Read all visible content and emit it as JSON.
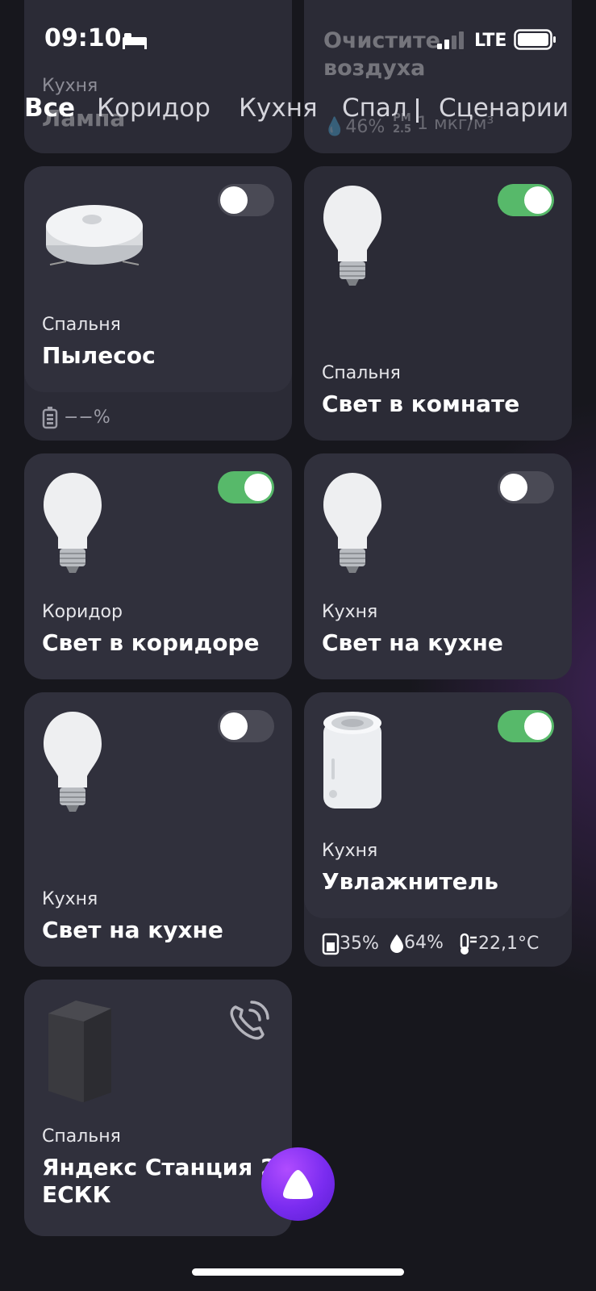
{
  "status_bar": {
    "time": "09:10",
    "network": "LTE"
  },
  "tabs": [
    {
      "label": "Все",
      "active": true
    },
    {
      "label": "Коридор",
      "active": false
    },
    {
      "label": "Кухня",
      "active": false
    },
    {
      "label": "Спал",
      "active": false
    },
    {
      "label": "Сценарии",
      "active": false
    }
  ],
  "top_cards": {
    "left": {
      "room": "Кухня",
      "name": "Лампа"
    },
    "right": {
      "name_line1": "Очистите",
      "name_line2": "воздуха",
      "humidity": "46%",
      "pm_label": "PM",
      "pm_sub": "2.5",
      "pm_value": "1 мкг/м³"
    }
  },
  "devices": [
    {
      "room": "Спальня",
      "name": "Пылесос",
      "state": "off",
      "battery": "−−%",
      "icon": "robot-vacuum-icon"
    },
    {
      "room": "Спальня",
      "name": "Свет в комнате",
      "state": "on",
      "icon": "lightbulb-icon"
    },
    {
      "room": "Коридор",
      "name": "Свет в коридоре",
      "state": "on",
      "icon": "lightbulb-icon"
    },
    {
      "room": "Кухня",
      "name": "Свет на кухне",
      "state": "off",
      "icon": "lightbulb-icon"
    },
    {
      "room": "Кухня",
      "name": "Свет на кухне",
      "state": "off",
      "icon": "lightbulb-icon"
    },
    {
      "room": "Кухня",
      "name": "Увлажнитель",
      "state": "on",
      "icon": "humidifier-icon",
      "water_level": "35%",
      "humidity": "64%",
      "temperature": "22,1°C"
    },
    {
      "room": "Спальня",
      "name_line1": "Яндекс Станция 2",
      "name_line2": "ЕСКК",
      "icon": "smart-speaker-icon"
    }
  ],
  "colors": {
    "toggle_on": "#57b96a",
    "toggle_off": "#4a4a55",
    "card": "#2b2b36",
    "alice": "#7a2cf0"
  }
}
